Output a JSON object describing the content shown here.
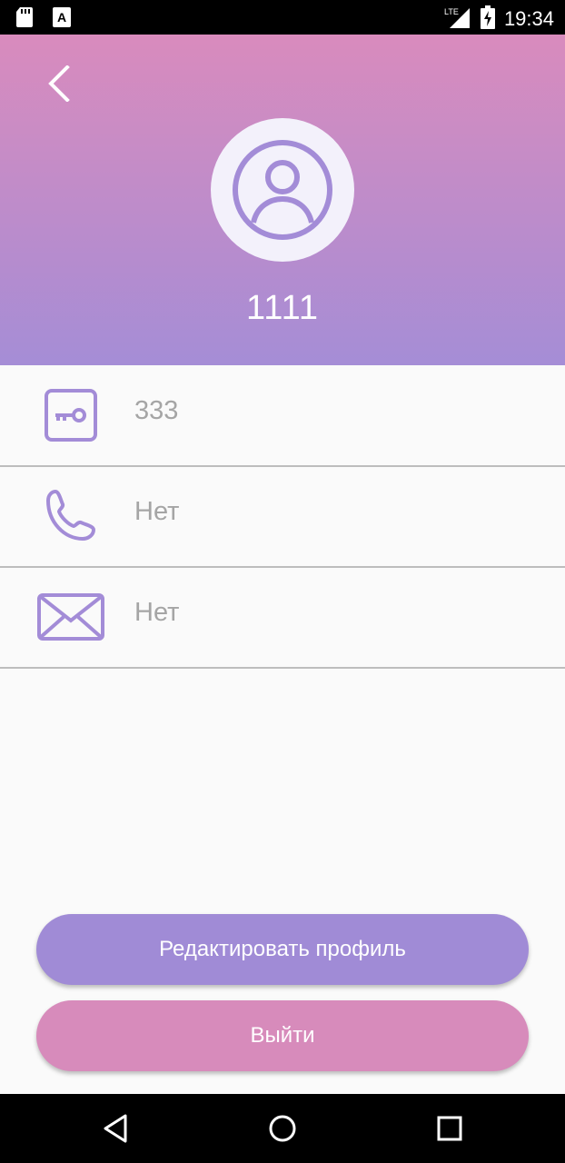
{
  "status_bar": {
    "time": "19:34",
    "network": "LTE"
  },
  "header": {
    "username": "1111"
  },
  "fields": [
    {
      "icon": "key-icon",
      "value": "333"
    },
    {
      "icon": "phone-icon",
      "value": "Нет"
    },
    {
      "icon": "mail-icon",
      "value": "Нет"
    }
  ],
  "buttons": {
    "edit": "Редактировать профиль",
    "logout": "Выйти"
  },
  "colors": {
    "gradient_top": "#d98bbd",
    "gradient_bottom": "#a58dd6",
    "accent": "#a08bd6",
    "logout": "#d78bbb",
    "field_text": "#a5a5a5"
  }
}
